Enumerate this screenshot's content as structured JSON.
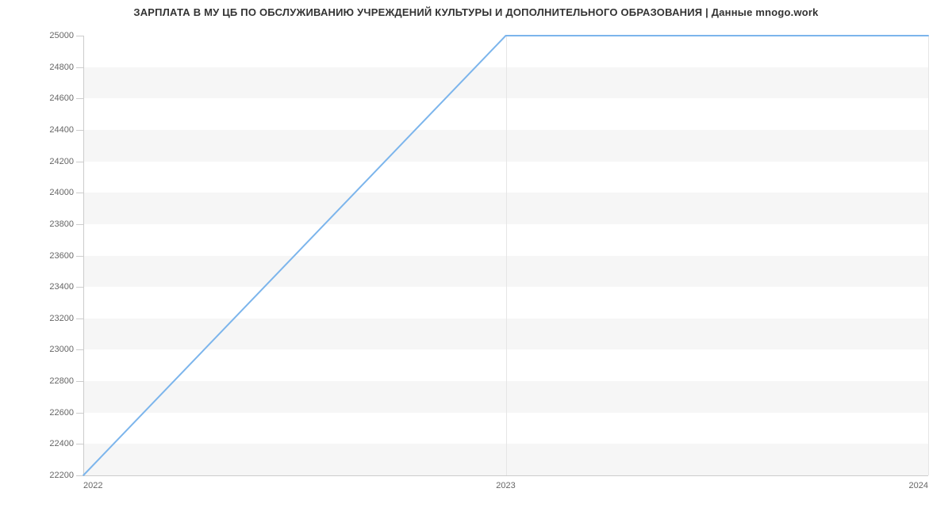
{
  "chart_data": {
    "type": "line",
    "title": "ЗАРПЛАТА В МУ ЦБ ПО ОБСЛУЖИВАНИЮ УЧРЕЖДЕНИЙ КУЛЬТУРЫ И ДОПОЛНИТЕЛЬНОГО ОБРАЗОВАНИЯ | Данные mnogo.work",
    "x": [
      2022,
      2023,
      2024
    ],
    "y": [
      22200,
      25000,
      25000
    ],
    "x_ticks": [
      2022,
      2023,
      2024
    ],
    "y_ticks": [
      22200,
      22400,
      22600,
      22800,
      23000,
      23200,
      23400,
      23600,
      23800,
      24000,
      24200,
      24400,
      24600,
      24800,
      25000
    ],
    "xlim": [
      2022,
      2024
    ],
    "ylim": [
      22200,
      25000
    ],
    "series_color": "#7cb5ec",
    "band_color": "#f6f6f6"
  }
}
